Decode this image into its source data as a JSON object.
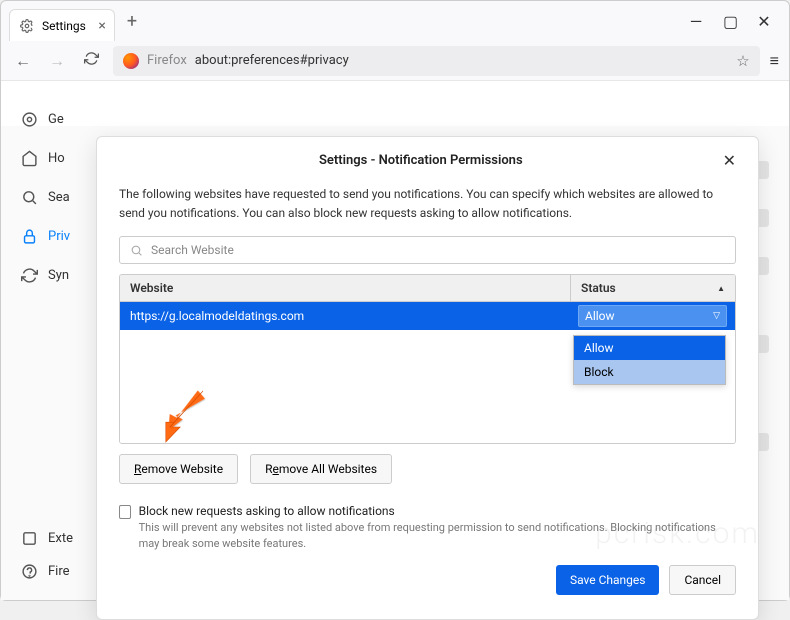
{
  "tab": {
    "title": "Settings"
  },
  "url": {
    "prefix": "Firefox",
    "path": "about:preferences#privacy"
  },
  "sidebar": {
    "items": [
      {
        "label": "Ge"
      },
      {
        "label": "Ho"
      },
      {
        "label": "Sea"
      },
      {
        "label": "Priv"
      },
      {
        "label": "Syn"
      }
    ],
    "bottom": [
      {
        "label": "Exte"
      },
      {
        "label": "Fire"
      }
    ]
  },
  "modal": {
    "title": "Settings - Notification Permissions",
    "desc": "The following websites have requested to send you notifications. You can specify which websites are allowed to send you notifications. You can also block new requests asking to allow notifications.",
    "search_placeholder": "Search Website",
    "columns": {
      "website": "Website",
      "status": "Status"
    },
    "rows": [
      {
        "url": "https://g.localmodeldatings.com",
        "status": "Allow"
      }
    ],
    "dropdown": {
      "opt1": "Allow",
      "opt2": "Block"
    },
    "remove_website": "Remove Website",
    "remove_all": "Remove All Websites",
    "block_new_label": "Block new requests asking to allow notifications",
    "block_new_sub": "This will prevent any websites not listed above from requesting permission to send notifications. Blocking notifications may break some website features.",
    "save": "Save Changes",
    "cancel": "Cancel"
  },
  "watermark": "pcrisk.com"
}
